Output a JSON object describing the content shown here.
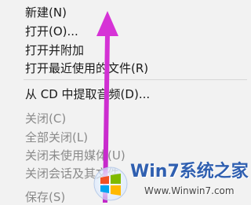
{
  "menu": {
    "items": [
      {
        "label": "新建(N)",
        "disabled": false
      },
      {
        "label": "打开(O)...",
        "disabled": false
      },
      {
        "label": "打开并附加",
        "disabled": false
      },
      {
        "label": "打开最近使用的文件(R)",
        "disabled": false
      },
      {
        "label": "从 CD 中提取音频(D)...",
        "disabled": false
      },
      {
        "label": "关闭(C)",
        "disabled": true
      },
      {
        "label": "全部关闭(L)",
        "disabled": true
      },
      {
        "label": "关闭未使用媒体(U)",
        "disabled": true
      },
      {
        "label": "关闭会话及其文件",
        "disabled": true
      },
      {
        "label": "保存(S)",
        "disabled": true
      }
    ]
  },
  "annotation": {
    "arrow_color": "#d633d6"
  },
  "watermark": {
    "title": "Win7系统之家",
    "url": "Www.Winwin7.com",
    "logo_icon": "windows-logo-icon"
  }
}
